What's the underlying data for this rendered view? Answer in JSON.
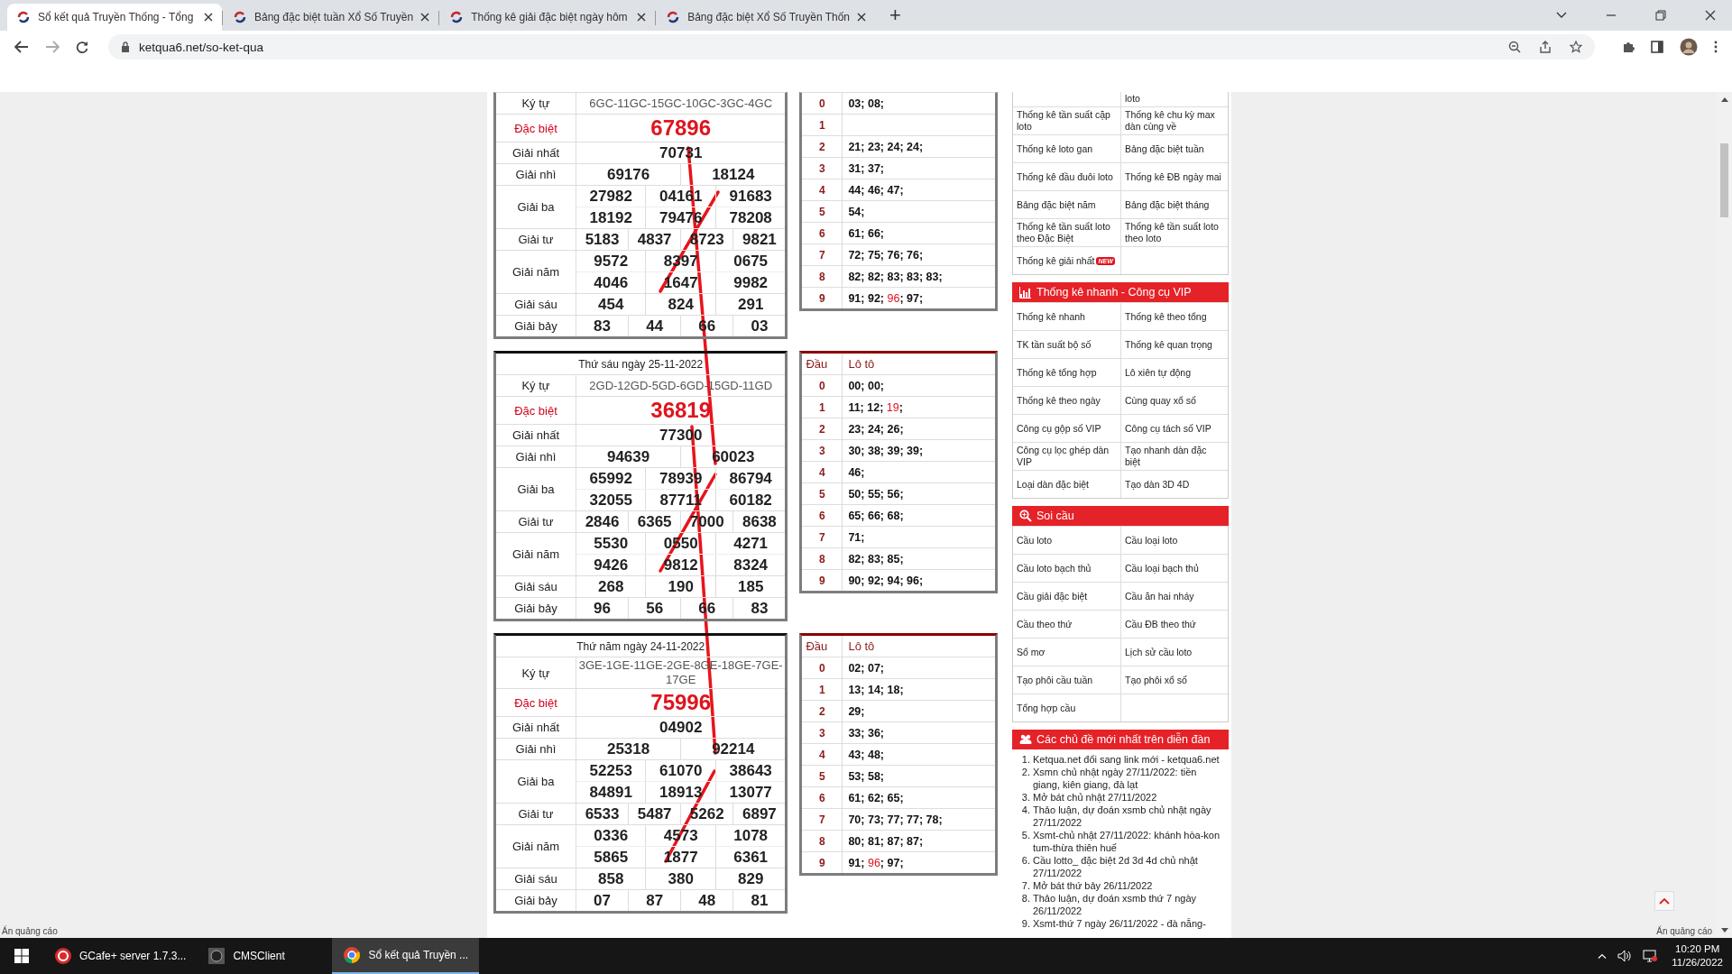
{
  "browser": {
    "tabs": [
      {
        "title": "Sổ kết quả Truyền Thống - Tổng",
        "selected": true
      },
      {
        "title": "Bảng đặc biệt tuần Xổ Số Truyền",
        "selected": false
      },
      {
        "title": "Thống kê giải đặc biệt ngày hôm",
        "selected": false
      },
      {
        "title": "Bảng đặc biệt Xổ Số Truyền Thốn",
        "selected": false
      }
    ],
    "new_tab": "+",
    "url": "ketqua6.net/so-ket-qua"
  },
  "days": [
    {
      "ky_tu_label": "Ký tự",
      "ky_tu": "6GC-11GC-15GC-10GC-3GC-4GC",
      "prizes": [
        {
          "name": "Đặc biệt",
          "kind": "special",
          "rows": [
            [
              "67896"
            ]
          ]
        },
        {
          "name": "Giải nhất",
          "kind": "normal",
          "rows": [
            [
              "70731"
            ]
          ]
        },
        {
          "name": "Giải nhì",
          "kind": "normal",
          "rows": [
            [
              "69176",
              "18124"
            ]
          ]
        },
        {
          "name": "Giải ba",
          "kind": "normal",
          "rows": [
            [
              "27982",
              "04161",
              "91683"
            ],
            [
              "18192",
              "79476",
              "78208"
            ]
          ]
        },
        {
          "name": "Giải tư",
          "kind": "normal",
          "rows": [
            [
              "5183",
              "4837",
              "8723",
              "9821"
            ]
          ]
        },
        {
          "name": "Giải năm",
          "kind": "normal",
          "rows": [
            [
              "9572",
              "8397",
              "0675"
            ],
            [
              "4046",
              "1647",
              "9982"
            ]
          ]
        },
        {
          "name": "Giải sáu",
          "kind": "normal",
          "rows": [
            [
              "454",
              "824",
              "291"
            ]
          ]
        },
        {
          "name": "Giải bảy",
          "kind": "normal",
          "rows": [
            [
              "83",
              "44",
              "66",
              "03"
            ]
          ]
        }
      ],
      "loto": {
        "rows": [
          {
            "dau": "0",
            "lo": [
              {
                "t": "03; 08;",
                "red": false
              }
            ]
          },
          {
            "dau": "1"
          },
          {
            "dau": "2",
            "lo": [
              {
                "t": "21; 23; 24; 24;",
                "red": false
              }
            ]
          },
          {
            "dau": "3",
            "lo": [
              {
                "t": "31; 37;",
                "red": false
              }
            ]
          },
          {
            "dau": "4",
            "lo": [
              {
                "t": "44; 46; 47;",
                "red": false
              }
            ]
          },
          {
            "dau": "5",
            "lo": [
              {
                "t": "54;",
                "red": false
              }
            ]
          },
          {
            "dau": "6",
            "lo": [
              {
                "t": "61; 66;",
                "red": false
              }
            ]
          },
          {
            "dau": "7",
            "lo": [
              {
                "t": "72; 75; 76; 76;",
                "red": false
              }
            ]
          },
          {
            "dau": "8",
            "lo": [
              {
                "t": "82; 82; 83; 83; 83;",
                "red": false
              }
            ]
          },
          {
            "dau": "9",
            "lo": [
              {
                "t": "91; 92; ",
                "red": false
              },
              {
                "t": "96",
                "red": true
              },
              {
                "t": "; 97;",
                "red": false
              }
            ]
          }
        ]
      }
    },
    {
      "date": "Thứ sáu ngày 25-11-2022",
      "ky_tu_label": "Ký tự",
      "ky_tu": "2GD-12GD-5GD-6GD-15GD-11GD",
      "prizes": [
        {
          "name": "Đặc biệt",
          "kind": "special",
          "rows": [
            [
              "36819"
            ]
          ]
        },
        {
          "name": "Giải nhất",
          "kind": "normal",
          "rows": [
            [
              "77300"
            ]
          ]
        },
        {
          "name": "Giải nhì",
          "kind": "normal",
          "rows": [
            [
              "94639",
              "60023"
            ]
          ]
        },
        {
          "name": "Giải ba",
          "kind": "normal",
          "rows": [
            [
              "65992",
              "78939",
              "86794"
            ],
            [
              "32055",
              "87711",
              "60182"
            ]
          ]
        },
        {
          "name": "Giải tư",
          "kind": "normal",
          "rows": [
            [
              "2846",
              "6365",
              "7000",
              "8638"
            ]
          ]
        },
        {
          "name": "Giải năm",
          "kind": "normal",
          "rows": [
            [
              "5530",
              "0550",
              "4271"
            ],
            [
              "9426",
              "9812",
              "8324"
            ]
          ]
        },
        {
          "name": "Giải sáu",
          "kind": "normal",
          "rows": [
            [
              "268",
              "190",
              "185"
            ]
          ]
        },
        {
          "name": "Giải bảy",
          "kind": "normal",
          "rows": [
            [
              "96",
              "56",
              "66",
              "83"
            ]
          ]
        }
      ],
      "loto": {
        "header": [
          "Đầu",
          "Lô tô"
        ],
        "rows": [
          {
            "dau": "0",
            "lo": [
              {
                "t": "00; 00;",
                "red": false
              }
            ]
          },
          {
            "dau": "1",
            "lo": [
              {
                "t": "11; 12; ",
                "red": false
              },
              {
                "t": "19",
                "red": true
              },
              {
                "t": ";",
                "red": false
              }
            ]
          },
          {
            "dau": "2",
            "lo": [
              {
                "t": "23; 24; 26;",
                "red": false
              }
            ]
          },
          {
            "dau": "3",
            "lo": [
              {
                "t": "30; 38; 39; 39;",
                "red": false
              }
            ]
          },
          {
            "dau": "4",
            "lo": [
              {
                "t": "46;",
                "red": false
              }
            ]
          },
          {
            "dau": "5",
            "lo": [
              {
                "t": "50; 55; 56;",
                "red": false
              }
            ]
          },
          {
            "dau": "6",
            "lo": [
              {
                "t": "65; 66; 68;",
                "red": false
              }
            ]
          },
          {
            "dau": "7",
            "lo": [
              {
                "t": "71;",
                "red": false
              }
            ]
          },
          {
            "dau": "8",
            "lo": [
              {
                "t": "82; 83; 85;",
                "red": false
              }
            ]
          },
          {
            "dau": "9",
            "lo": [
              {
                "t": "90; 92; 94; 96;",
                "red": false
              }
            ]
          }
        ]
      }
    },
    {
      "date": "Thứ năm ngày 24-11-2022",
      "ky_tu_label": "Ký tự",
      "ky_tu": "3GE-1GE-11GE-2GE-8GE-18GE-7GE-17GE",
      "prizes": [
        {
          "name": "Đặc biệt",
          "kind": "special",
          "rows": [
            [
              "75996"
            ]
          ]
        },
        {
          "name": "Giải nhất",
          "kind": "normal",
          "rows": [
            [
              "04902"
            ]
          ]
        },
        {
          "name": "Giải nhì",
          "kind": "normal",
          "rows": [
            [
              "25318",
              "92214"
            ]
          ]
        },
        {
          "name": "Giải ba",
          "kind": "normal",
          "rows": [
            [
              "52253",
              "61070",
              "38643"
            ],
            [
              "84891",
              "18913",
              "13077"
            ]
          ]
        },
        {
          "name": "Giải tư",
          "kind": "normal",
          "rows": [
            [
              "6533",
              "5487",
              "5262",
              "6897"
            ]
          ]
        },
        {
          "name": "Giải năm",
          "kind": "normal",
          "rows": [
            [
              "0336",
              "4573",
              "1078"
            ],
            [
              "5865",
              "1877",
              "6361"
            ]
          ]
        },
        {
          "name": "Giải sáu",
          "kind": "normal",
          "rows": [
            [
              "858",
              "380",
              "829"
            ]
          ]
        },
        {
          "name": "Giải bảy",
          "kind": "normal",
          "rows": [
            [
              "07",
              "87",
              "48",
              "81"
            ]
          ]
        }
      ],
      "loto": {
        "header": [
          "Đầu",
          "Lô tô"
        ],
        "rows": [
          {
            "dau": "0",
            "lo": [
              {
                "t": "02; 07;",
                "red": false
              }
            ]
          },
          {
            "dau": "1",
            "lo": [
              {
                "t": "13; 14; 18;",
                "red": false
              }
            ]
          },
          {
            "dau": "2",
            "lo": [
              {
                "t": "29;",
                "red": false
              }
            ]
          },
          {
            "dau": "3",
            "lo": [
              {
                "t": "33; 36;",
                "red": false
              }
            ]
          },
          {
            "dau": "4",
            "lo": [
              {
                "t": "43; 48;",
                "red": false
              }
            ]
          },
          {
            "dau": "5",
            "lo": [
              {
                "t": "53; 58;",
                "red": false
              }
            ]
          },
          {
            "dau": "6",
            "lo": [
              {
                "t": "61; 62; 65;",
                "red": false
              }
            ]
          },
          {
            "dau": "7",
            "lo": [
              {
                "t": "70; 73; 77; 77; 78;",
                "red": false
              }
            ]
          },
          {
            "dau": "8",
            "lo": [
              {
                "t": "80; 81; 87; 87;",
                "red": false
              }
            ]
          },
          {
            "dau": "9",
            "lo": [
              {
                "t": "91; ",
                "red": false
              },
              {
                "t": "96",
                "red": true
              },
              {
                "t": "; 97;",
                "red": false
              }
            ]
          }
        ]
      }
    }
  ],
  "sidebar": {
    "sections": [
      {
        "kind": "grid",
        "rows": [
          {
            "right": "loto",
            "partial": true
          },
          {
            "left": "Thống kê tần suất cặp loto",
            "right": "Thống kê chu kỳ max dàn cùng về"
          },
          {
            "left": "Thống kê loto gan",
            "right": "Bảng đặc biệt tuần"
          },
          {
            "left": "Thống kê đầu đuôi loto",
            "right": "Thống kê ĐB ngày mai"
          },
          {
            "left": "Bảng đặc biệt năm",
            "right": "Bảng đặc biệt tháng"
          },
          {
            "left": "Thống kê tần suất loto theo Đặc Biệt",
            "right": "Thống kê tần suất loto theo loto"
          },
          {
            "left": "Thống kê giải nhất",
            "badge": "NEW"
          }
        ]
      },
      {
        "kind": "grid",
        "title": "Thống kê nhanh - Công cụ VIP",
        "rows": [
          {
            "left": "Thống kê nhanh",
            "right": "Thống kê theo tổng"
          },
          {
            "left": "TK tần suất bộ số",
            "right": "Thống kê quan trọng"
          },
          {
            "left": "Thống kê tổng hợp",
            "right": "Lô xiên tự động"
          },
          {
            "left": "Thống kê theo ngày",
            "right": "Cùng quay xổ số"
          },
          {
            "left": "Công cụ gộp số VIP",
            "right": "Công cụ tách số VIP"
          },
          {
            "left": "Công cụ lọc ghép dàn VIP",
            "right": "Tạo nhanh dàn đặc biệt"
          },
          {
            "left": "Loại dàn đặc biệt",
            "right": "Tạo dàn 3D 4D"
          }
        ]
      },
      {
        "kind": "grid",
        "title": "Soi cầu",
        "rows": [
          {
            "left": "Cầu loto",
            "right": "Cầu loại loto"
          },
          {
            "left": "Cầu loto bạch thủ",
            "right": "Cầu loại bạch thủ"
          },
          {
            "left": "Cầu giải đặc biệt",
            "right": "Cầu ăn hai nháy"
          },
          {
            "left": "Cầu theo thứ",
            "right": "Cầu ĐB theo thứ"
          },
          {
            "left": "Sổ mơ",
            "right": "Lịch sử cầu loto"
          },
          {
            "left": "Tạo phôi cầu tuần",
            "right": "Tạo phôi xổ số"
          },
          {
            "left": "Tổng hợp cầu"
          }
        ]
      },
      {
        "kind": "list",
        "title": "Các chủ đề mới nhất trên diễn đàn",
        "items": [
          {
            "num": "1.",
            "text": "Ketqua.net đổi sang link mới - ketqua6.net"
          },
          {
            "num": "2.",
            "text": "Xsmn chủ nhật ngày 27/11/2022: tiền giang, kiên giang, đà lạt"
          },
          {
            "num": "3.",
            "text": "Mở bát chủ nhật 27/11/2022"
          },
          {
            "num": "4.",
            "text": "Thảo luận, dự đoán xsmb chủ nhật ngày 27/11/2022"
          },
          {
            "num": "5.",
            "text": "Xsmt-chủ nhật 27/11/2022: khánh hòa-kon tum-thừa thiên huế"
          },
          {
            "num": "6.",
            "text": "Cầu lotto_ đặc biệt 2d 3d 4d chủ nhật 27/11/2022"
          },
          {
            "num": "7.",
            "text": "Mở bát thứ bảy 26/11/2022"
          },
          {
            "num": "8.",
            "text": "Thảo luận, dự đoán xsmb thứ 7 ngày 26/11/2022"
          },
          {
            "num": "9.",
            "text": "Xsmt-thứ 7 ngày 26/11/2022 - đà nẵng-"
          }
        ]
      }
    ]
  },
  "ads": [
    "Ẩn quảng cáo",
    "Ẩn quảng cáo"
  ],
  "taskbar": {
    "items": [
      {
        "label": "GCafe+ server 1.7.3...",
        "kind": "gcafe",
        "active": false
      },
      {
        "label": "CMSClient",
        "kind": "cms",
        "active": false
      },
      {
        "label": "Sổ kết quả Truyền ...",
        "kind": "chrome",
        "active": true
      }
    ],
    "time": "10:20 PM",
    "date": "11/26/2022"
  }
}
